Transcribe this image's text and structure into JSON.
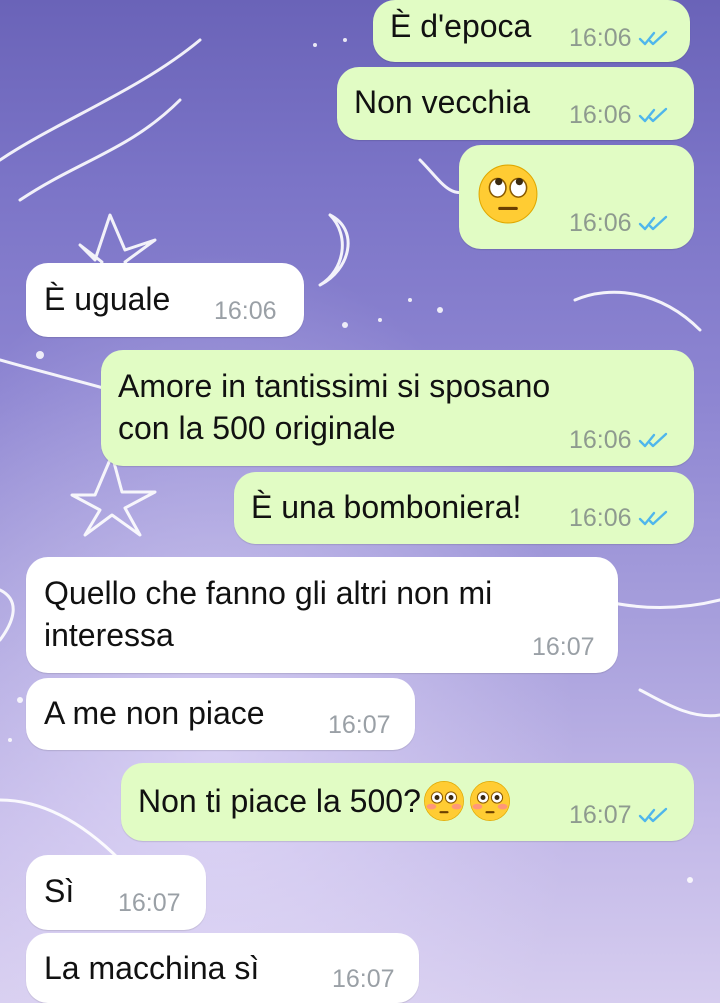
{
  "messages": [
    {
      "dir": "out",
      "text": "È d'epoca",
      "time": "16:06",
      "status": "read"
    },
    {
      "dir": "out",
      "text": "Non vecchia",
      "time": "16:06",
      "status": "read"
    },
    {
      "dir": "out",
      "text": "",
      "emoji": "face-with-rolling-eyes",
      "time": "16:06",
      "status": "read"
    },
    {
      "dir": "in",
      "text": "È uguale",
      "time": "16:06"
    },
    {
      "dir": "out",
      "text_line1": "Amore in tantissimi si sposano",
      "text_line2": "con la 500 originale",
      "time": "16:06",
      "status": "read"
    },
    {
      "dir": "out",
      "text": "È una bomboniera!",
      "time": "16:06",
      "status": "read"
    },
    {
      "dir": "in",
      "text_line1": "Quello che fanno gli altri non mi",
      "text_line2": "interessa",
      "time": "16:07"
    },
    {
      "dir": "in",
      "text": "A me non piace",
      "time": "16:07"
    },
    {
      "dir": "out",
      "text": "Non ti piace la 500?",
      "emoji": "flushed-face",
      "emoji_count": 2,
      "time": "16:07",
      "status": "read"
    },
    {
      "dir": "in",
      "text": "Sì",
      "time": "16:07"
    },
    {
      "dir": "in",
      "text": "La macchina sì",
      "time": "16:07"
    }
  ],
  "colors": {
    "outgoing_bubble": "#e1fcc4",
    "incoming_bubble": "#ffffff",
    "read_tick": "#4fb6ec",
    "time_text": "#8e9a8f"
  },
  "icons": [
    "double-check-read-icon",
    "face-with-rolling-eyes-emoji",
    "flushed-face-emoji"
  ]
}
